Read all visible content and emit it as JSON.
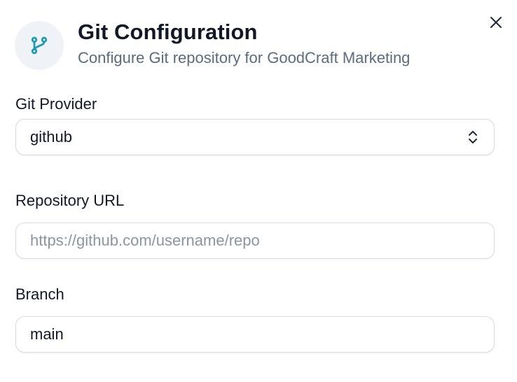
{
  "dialog": {
    "title": "Git Configuration",
    "subtitle": "Configure Git repository for GoodCraft Marketing",
    "header_icon": "git-branch-icon",
    "close_icon": "close-icon",
    "accent_color": "#1e9ab3"
  },
  "form": {
    "provider": {
      "label": "Git Provider",
      "value": "github",
      "icon": "chevron-up-down-icon"
    },
    "repository_url": {
      "label": "Repository URL",
      "value": "",
      "placeholder": "https://github.com/username/repo"
    },
    "branch": {
      "label": "Branch",
      "value": "main"
    }
  }
}
